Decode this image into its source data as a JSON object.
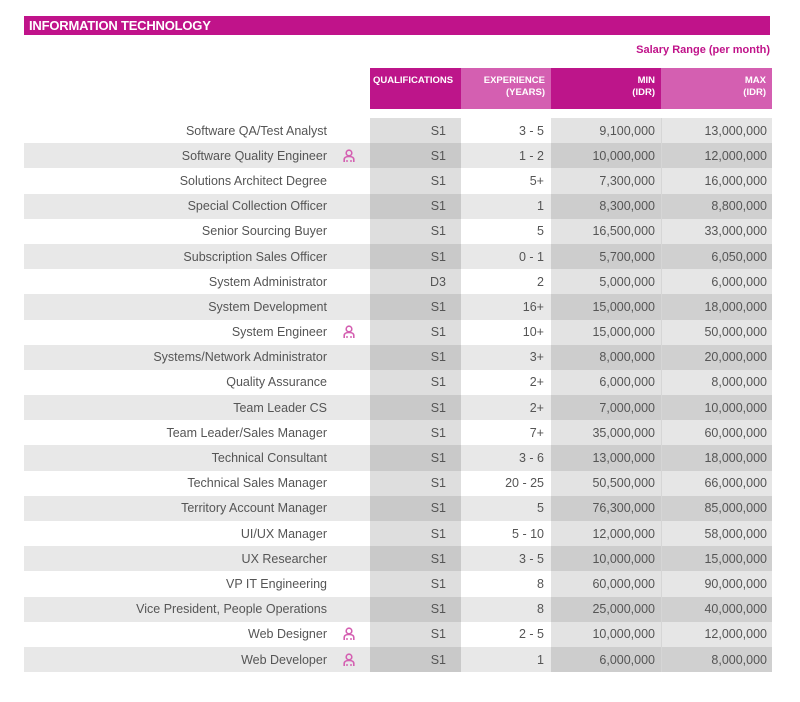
{
  "section_title": "INFORMATION TECHNOLOGY",
  "salary_range_label": "Salary Range (per month)",
  "colors": {
    "accent": "#c0138a",
    "accent_light": "#d45fb1"
  },
  "headers": {
    "qualifications": "QUALIFICATIONS",
    "experience_line1": "EXPERIENCE",
    "experience_line2": "(YEARS)",
    "min_line1": "MIN",
    "min_line2": "(IDR)",
    "max_line1": "MAX",
    "max_line2": "(IDR)"
  },
  "rows": [
    {
      "title": "Software QA/Test Analyst",
      "icon": "",
      "qualification": "S1",
      "experience": "3 - 5",
      "min": "9,100,000",
      "max": "13,000,000"
    },
    {
      "title": "Software Quality Engineer",
      "icon": "person-icon",
      "qualification": "S1",
      "experience": "1 - 2",
      "min": "10,000,000",
      "max": "12,000,000"
    },
    {
      "title": "Solutions Architect Degree",
      "icon": "",
      "qualification": "S1",
      "experience": "5+",
      "min": "7,300,000",
      "max": "16,000,000"
    },
    {
      "title": "Special Collection Officer",
      "icon": "",
      "qualification": "S1",
      "experience": "1",
      "min": "8,300,000",
      "max": "8,800,000"
    },
    {
      "title": "Senior Sourcing Buyer",
      "icon": "",
      "qualification": "S1",
      "experience": "5",
      "min": "16,500,000",
      "max": "33,000,000"
    },
    {
      "title": "Subscription Sales Officer",
      "icon": "",
      "qualification": "S1",
      "experience": "0 - 1",
      "min": "5,700,000",
      "max": "6,050,000"
    },
    {
      "title": "System Administrator",
      "icon": "",
      "qualification": "D3",
      "experience": "2",
      "min": "5,000,000",
      "max": "6,000,000"
    },
    {
      "title": "System Development",
      "icon": "",
      "qualification": "S1",
      "experience": "16+",
      "min": "15,000,000",
      "max": "18,000,000"
    },
    {
      "title": "System Engineer",
      "icon": "person-icon",
      "qualification": "S1",
      "experience": "10+",
      "min": "15,000,000",
      "max": "50,000,000"
    },
    {
      "title": "Systems/Network Administrator",
      "icon": "",
      "qualification": "S1",
      "experience": "3+",
      "min": "8,000,000",
      "max": "20,000,000"
    },
    {
      "title": "Quality Assurance",
      "icon": "",
      "qualification": "S1",
      "experience": "2+",
      "min": "6,000,000",
      "max": "8,000,000"
    },
    {
      "title": "Team Leader CS",
      "icon": "",
      "qualification": "S1",
      "experience": "2+",
      "min": "7,000,000",
      "max": "10,000,000"
    },
    {
      "title": "Team Leader/Sales Manager",
      "icon": "",
      "qualification": "S1",
      "experience": "7+",
      "min": "35,000,000",
      "max": "60,000,000"
    },
    {
      "title": "Technical Consultant",
      "icon": "",
      "qualification": "S1",
      "experience": "3 - 6",
      "min": "13,000,000",
      "max": "18,000,000"
    },
    {
      "title": "Technical Sales Manager",
      "icon": "",
      "qualification": "S1",
      "experience": "20 - 25",
      "min": "50,500,000",
      "max": "66,000,000"
    },
    {
      "title": "Territory Account Manager",
      "icon": "",
      "qualification": "S1",
      "experience": "5",
      "min": "76,300,000",
      "max": "85,000,000"
    },
    {
      "title": "UI/UX Manager",
      "icon": "",
      "qualification": "S1",
      "experience": "5 - 10",
      "min": "12,000,000",
      "max": "58,000,000"
    },
    {
      "title": "UX Researcher",
      "icon": "",
      "qualification": "S1",
      "experience": "3 - 5",
      "min": "10,000,000",
      "max": "15,000,000"
    },
    {
      "title": "VP IT Engineering",
      "icon": "",
      "qualification": "S1",
      "experience": "8",
      "min": "60,000,000",
      "max": "90,000,000"
    },
    {
      "title": "Vice President, People Operations",
      "icon": "",
      "qualification": "S1",
      "experience": "8",
      "min": "25,000,000",
      "max": "40,000,000"
    },
    {
      "title": "Web Designer",
      "icon": "person-icon",
      "qualification": "S1",
      "experience": "2 - 5",
      "min": "10,000,000",
      "max": "12,000,000"
    },
    {
      "title": "Web Developer",
      "icon": "person-icon",
      "qualification": "S1",
      "experience": "1",
      "min": "6,000,000",
      "max": "8,000,000"
    }
  ]
}
